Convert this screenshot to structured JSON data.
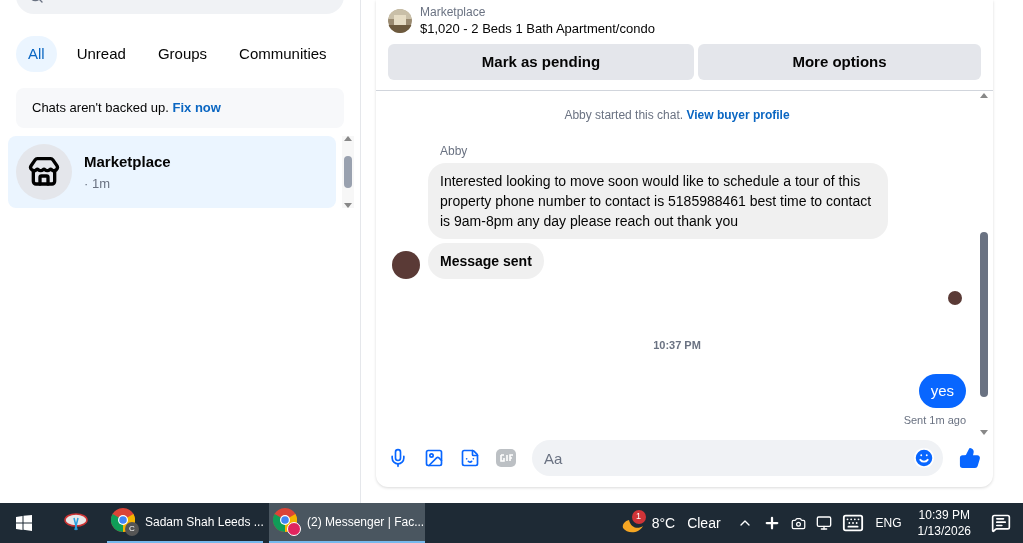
{
  "filters": [
    {
      "label": "All",
      "selected": true
    },
    {
      "label": "Unread",
      "selected": false
    },
    {
      "label": "Groups",
      "selected": false
    },
    {
      "label": "Communities",
      "selected": false
    }
  ],
  "backup_notice": {
    "text": "Chats aren't backed up.",
    "link": "Fix now"
  },
  "chats": [
    {
      "name": "Marketplace",
      "time": "· 1m",
      "selected": true
    }
  ],
  "listing": {
    "source": "Marketplace",
    "title": "$1,020 - 2 Beds 1 Bath Apartment/condo"
  },
  "listing_buttons": [
    "Mark as pending",
    "More options"
  ],
  "messages": [
    {
      "kind": "system",
      "text": "Abby started this chat.",
      "link": "View buyer profile"
    },
    {
      "kind": "sender",
      "text": "Abby"
    },
    {
      "kind": "incoming",
      "text": "Interested looking to move soon would like to schedule a tour of this property phone number to contact is 5185988461 best time to contact is 9am-8pm any day please reach out thank you",
      "bold": false,
      "avatar": false
    },
    {
      "kind": "incoming",
      "text": "Message sent",
      "bold": true,
      "avatar": true
    },
    {
      "kind": "seen"
    },
    {
      "kind": "timestamp",
      "text": "10:37 PM"
    },
    {
      "kind": "outgoing",
      "text": "yes"
    },
    {
      "kind": "status",
      "text": "Sent 1m ago"
    }
  ],
  "composer": {
    "placeholder": "Aa"
  },
  "taskbar": {
    "tasks": [
      {
        "label": "Sadam Shah Leeds ...",
        "selected": false,
        "badge": "C"
      },
      {
        "label": "(2) Messenger | Fac...",
        "selected": true
      }
    ],
    "weather": {
      "badge": "1",
      "temperature": "8°C",
      "condition": "Clear"
    },
    "language": "ENG",
    "time": "10:39 PM",
    "date": "1/13/2026"
  }
}
